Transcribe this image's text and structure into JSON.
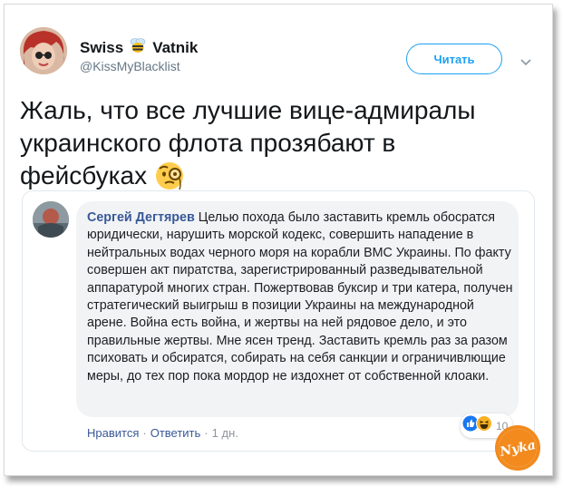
{
  "tweet": {
    "display_name_left": "Swiss",
    "display_name_right": "Vatnik",
    "handle": "@KissMyBlacklist",
    "follow_label": "Читать",
    "text": "Жаль, что все лучшие вице-адмиралы украинского флота прозябают в фейсбуках"
  },
  "quoted_comment": {
    "author": "Сергей Дегтярев",
    "body": "Целью похода было заставить кремль обосратся юридически, нарушить морской кодекс, совершить нападение в нейтральных водах черного моря на корабли ВМС Украины. По факту совершен акт пиратства, зарегистрированный разведывательной аппаратурой многих стран. Пожертвовав буксир и три катера, получен стратегический выигрыш в позиции Украины на международной арене. Война есть война, и жертвы на ней рядовое дело, и это правильные жертвы. Мне ясен тренд. Заставить кремль раз за разом психовать и обсиратся, собирать на себя санкции и ограничивлющие меры, до тех пор пока мордор не издохнет от собственной клоаки.",
    "like_label": "Нравится",
    "separator": "·",
    "reply_label": "Ответить",
    "time": "1 дн.",
    "reaction_count": "10"
  },
  "watermark": "Nyka",
  "colors": {
    "twitter_blue": "#1da1f2",
    "fb_link": "#385898",
    "bubble": "#f2f3f5"
  },
  "icons": [
    "bee-emoji-icon",
    "chevron-down-icon",
    "monocle-face-emoji-icon",
    "like-reaction-icon",
    "haha-reaction-icon"
  ]
}
